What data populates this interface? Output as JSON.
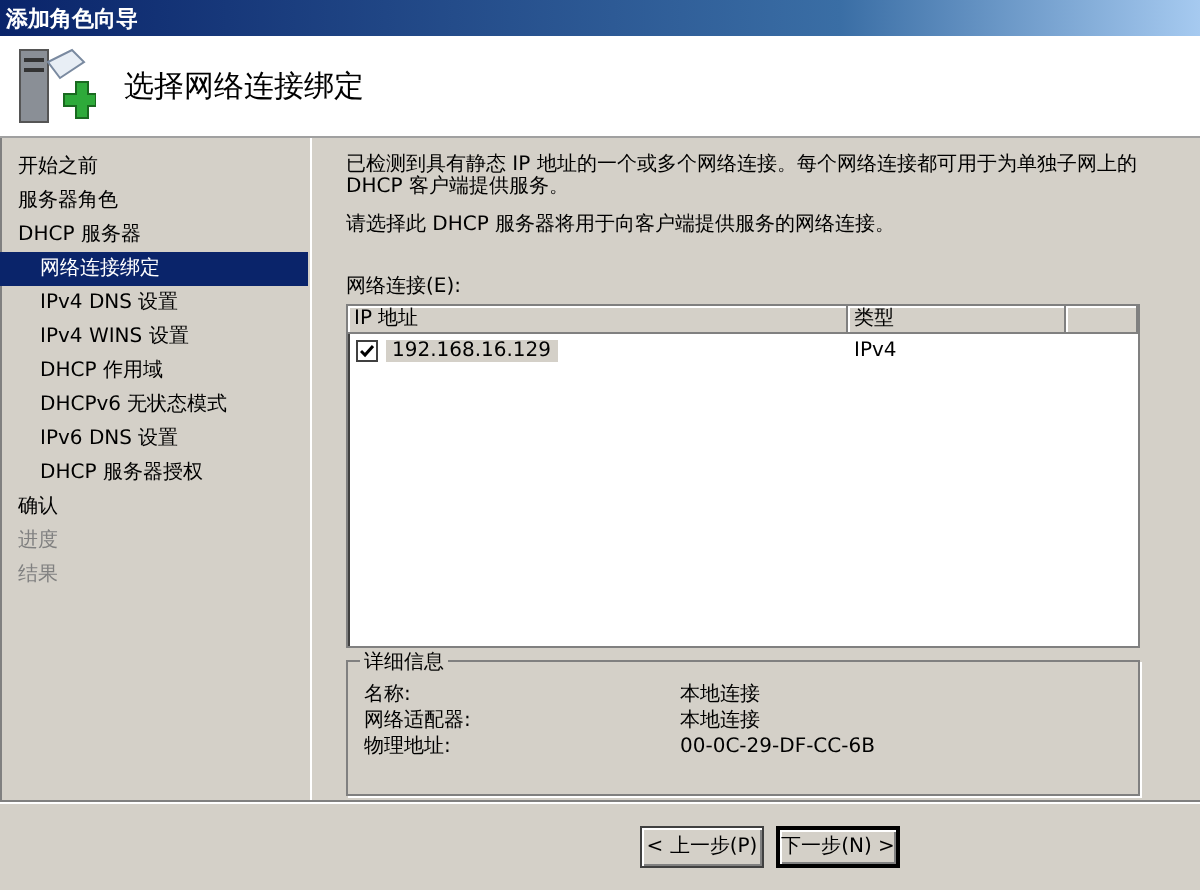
{
  "window": {
    "title": "添加角色向导"
  },
  "header": {
    "title": "选择网络连接绑定"
  },
  "sidebar": {
    "items": [
      {
        "label": "开始之前",
        "selected": false,
        "disabled": false
      },
      {
        "label": "服务器角色",
        "selected": false,
        "disabled": false
      },
      {
        "label": "DHCP 服务器",
        "selected": false,
        "disabled": false,
        "children": [
          {
            "label": "网络连接绑定",
            "selected": true,
            "disabled": false
          },
          {
            "label": "IPv4 DNS 设置",
            "selected": false,
            "disabled": false
          },
          {
            "label": "IPv4 WINS 设置",
            "selected": false,
            "disabled": false
          },
          {
            "label": "DHCP 作用域",
            "selected": false,
            "disabled": false
          },
          {
            "label": "DHCPv6 无状态模式",
            "selected": false,
            "disabled": false
          },
          {
            "label": "IPv6 DNS 设置",
            "selected": false,
            "disabled": false
          },
          {
            "label": "DHCP 服务器授权",
            "selected": false,
            "disabled": false
          }
        ]
      },
      {
        "label": "确认",
        "selected": false,
        "disabled": false
      },
      {
        "label": "进度",
        "selected": false,
        "disabled": true
      },
      {
        "label": "结果",
        "selected": false,
        "disabled": true
      }
    ]
  },
  "content": {
    "intro": "已检测到具有静态 IP 地址的一个或多个网络连接。每个网络连接都可用于为单独子网上的 DHCP 客户端提供服务。",
    "instruction": "请选择此 DHCP 服务器将用于向客户端提供服务的网络连接。",
    "list_label": "网络连接(E):",
    "table": {
      "columns": [
        "IP 地址",
        "类型"
      ],
      "rows": [
        {
          "cells": [
            "192.168.16.129",
            "IPv4"
          ],
          "checked": true,
          "selected": true
        }
      ]
    },
    "details": {
      "title": "详细信息",
      "rows": [
        {
          "label": "名称:",
          "value": "本地连接"
        },
        {
          "label": "网络适配器:",
          "value": "本地连接"
        },
        {
          "label": "物理地址:",
          "value": "00-0C-29-DF-CC-6B"
        }
      ]
    }
  },
  "buttons": [
    "< 上一步(P)",
    "下一步(N) >"
  ]
}
